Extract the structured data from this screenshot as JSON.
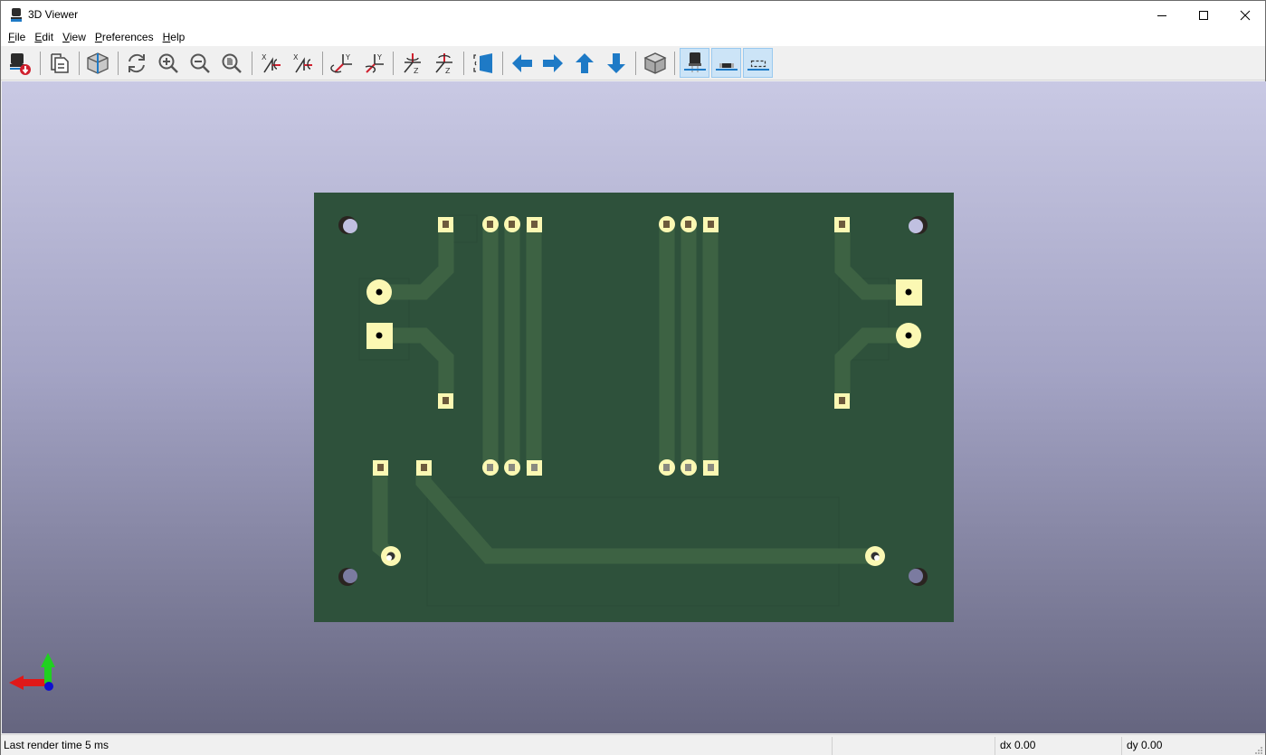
{
  "window": {
    "title": "3D Viewer",
    "controls": [
      "minimize-icon",
      "maximize-icon",
      "close-icon"
    ]
  },
  "menu": [
    {
      "label": "File",
      "mnemonic": "F",
      "rest": "ile"
    },
    {
      "label": "Edit",
      "mnemonic": "E",
      "rest": "dit"
    },
    {
      "label": "View",
      "mnemonic": "V",
      "rest": "iew"
    },
    {
      "label": "Preferences",
      "mnemonic": "P",
      "rest": "references"
    },
    {
      "label": "Help",
      "mnemonic": "H",
      "rest": "elp"
    }
  ],
  "toolbar": {
    "buttons": [
      {
        "name": "reload-board-button",
        "icon": "reload-board-icon",
        "active": false
      },
      {
        "name": "copy-3d-image-button",
        "icon": "copy-icon",
        "active": false
      },
      {
        "name": "raytracing-button",
        "icon": "render-cube-icon",
        "active": false
      },
      {
        "name": "refresh-button",
        "icon": "refresh-icon",
        "active": false
      },
      {
        "name": "zoom-in-button",
        "icon": "zoom-in-icon",
        "active": false
      },
      {
        "name": "zoom-out-button",
        "icon": "zoom-out-icon",
        "active": false
      },
      {
        "name": "zoom-fit-button",
        "icon": "zoom-fit-icon",
        "active": false
      },
      {
        "name": "rotate-x-cw-button",
        "icon": "rotate-x-cw-icon",
        "active": false
      },
      {
        "name": "rotate-x-ccw-button",
        "icon": "rotate-x-ccw-icon",
        "active": false
      },
      {
        "name": "rotate-y-cw-button",
        "icon": "rotate-y-cw-icon",
        "active": false
      },
      {
        "name": "rotate-y-ccw-button",
        "icon": "rotate-y-ccw-icon",
        "active": false
      },
      {
        "name": "rotate-z-cw-button",
        "icon": "rotate-z-cw-icon",
        "active": false
      },
      {
        "name": "rotate-z-ccw-button",
        "icon": "rotate-z-ccw-icon",
        "active": false
      },
      {
        "name": "flip-board-button",
        "icon": "flip-board-icon",
        "active": false
      },
      {
        "name": "pan-left-button",
        "icon": "arrow-left-icon",
        "active": false
      },
      {
        "name": "pan-right-button",
        "icon": "arrow-right-icon",
        "active": false
      },
      {
        "name": "pan-up-button",
        "icon": "arrow-up-icon",
        "active": false
      },
      {
        "name": "pan-down-button",
        "icon": "arrow-down-icon",
        "active": false
      },
      {
        "name": "orthographic-toggle-button",
        "icon": "ortho-cube-icon",
        "active": false
      },
      {
        "name": "show-through-hole-models-button",
        "icon": "through-hole-component-icon",
        "active": true
      },
      {
        "name": "show-smd-models-button",
        "icon": "smd-component-icon",
        "active": true
      },
      {
        "name": "show-virtual-models-button",
        "icon": "virtual-component-icon",
        "active": true
      }
    ]
  },
  "colors": {
    "board": "#2e513b",
    "track": "#3d6243",
    "pad": "#fbf8b3",
    "accent_blue": "#1e7ac6",
    "active_bg": "#cce4f7"
  },
  "statusbar": {
    "render_time": "Last render time 5 ms",
    "dx": "dx 0.00",
    "dy": "dy 0.00"
  }
}
